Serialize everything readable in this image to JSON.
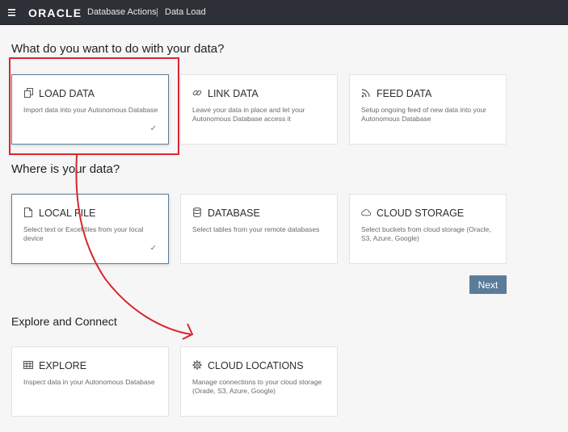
{
  "topbar": {
    "brand": "ORACLE",
    "app_title": "Database Actions",
    "separator": "|",
    "page_title": "Data Load"
  },
  "section1": {
    "heading": "What do you want to do with your data?",
    "cards": [
      {
        "title": "LOAD DATA",
        "desc": "Import data into your Autonomous Database",
        "selected": true
      },
      {
        "title": "LINK DATA",
        "desc": "Leave your data in place and let your Autonomous Database access it",
        "selected": false
      },
      {
        "title": "FEED DATA",
        "desc": "Setup ongoing feed of new data into your Autonomous Database",
        "selected": false
      }
    ]
  },
  "section2": {
    "heading": "Where is your data?",
    "cards": [
      {
        "title": "LOCAL FILE",
        "desc": "Select text or Excel files from your local device",
        "selected": true
      },
      {
        "title": "DATABASE",
        "desc": "Select tables from your remote databases",
        "selected": false
      },
      {
        "title": "CLOUD STORAGE",
        "desc": "Select buckets from cloud storage (Oracle, S3, Azure, Google)",
        "selected": false
      }
    ]
  },
  "next_label": "Next",
  "section3": {
    "heading": "Explore and Connect",
    "cards": [
      {
        "title": "EXPLORE",
        "desc": "Inspect data in your Autonomous Database"
      },
      {
        "title": "CLOUD LOCATIONS",
        "desc": "Manage connections to your cloud storage (Orade, S3, Azure, Google)"
      }
    ]
  },
  "check_glyph": "✓",
  "colors": {
    "topbar": "#2d3037",
    "accent": "#5b7c99",
    "annotation": "#d8262f",
    "background": "#f6f6f6"
  }
}
